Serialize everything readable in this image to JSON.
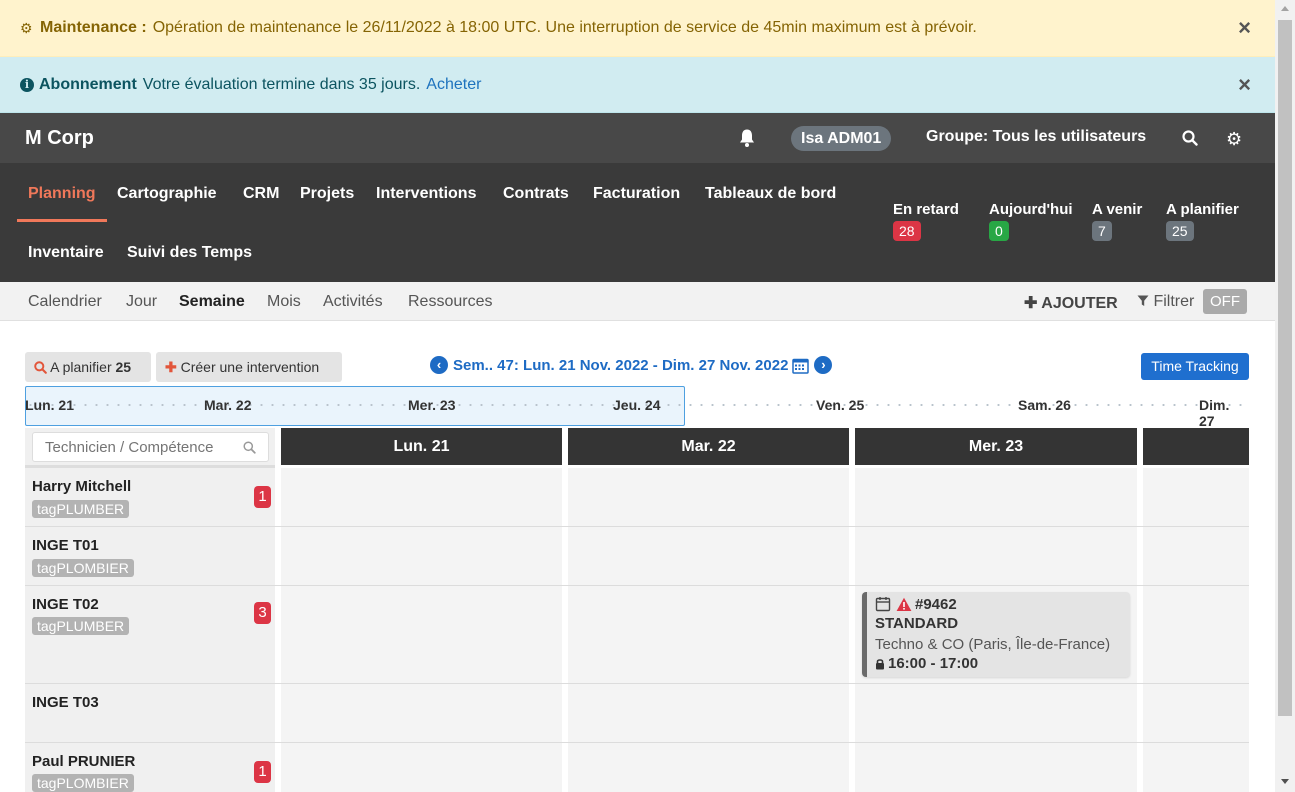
{
  "alerts": {
    "maintenance": {
      "title": "Maintenance :",
      "message": "Opération de maintenance le 26/11/2022 à 18:00 UTC. Une interruption de service de 45min maximum est à prévoir."
    },
    "subscription": {
      "title": "Abonnement",
      "message": "Votre évaluation termine dans 35 jours.",
      "link": "Acheter"
    },
    "close_glyph": "×"
  },
  "topbar": {
    "brand": "M Corp",
    "user": "Isa ADM01",
    "group": "Groupe: Tous les utilisateurs"
  },
  "mainnav": {
    "items": [
      "Planning",
      "Cartographie",
      "CRM",
      "Projets",
      "Interventions",
      "Contrats",
      "Facturation",
      "Tableaux de bord",
      "Inventaire",
      "Suivi des Temps"
    ],
    "stats": [
      {
        "label": "En retard",
        "value": "28",
        "color": "#dc3545"
      },
      {
        "label": "Aujourd'hui",
        "value": "0",
        "color": "#28a745"
      },
      {
        "label": "A venir",
        "value": "7",
        "color": "#6c757d"
      },
      {
        "label": "A planifier",
        "value": "25",
        "color": "#6c757d"
      }
    ]
  },
  "subnav": {
    "items": [
      "Calendrier",
      "Jour",
      "Semaine",
      "Mois",
      "Activités",
      "Ressources"
    ],
    "active": "Semaine",
    "add_label": "AJOUTER",
    "filter_label": "Filtrer",
    "filter_state": "OFF"
  },
  "toolbar": {
    "to_plan_label": "A planifier",
    "to_plan_count": "25",
    "create_label": "Créer une intervention",
    "week_label": "Sem.. 47: Lun. 21 Nov. 2022 - Dim. 27 Nov. 2022",
    "time_tracking": "Time Tracking"
  },
  "daystrip": [
    "Lun. 21",
    "Mar. 22",
    "Mer. 23",
    "Jeu. 24",
    "Ven. 25",
    "Sam. 26",
    "Dim. 27"
  ],
  "grid": {
    "search_placeholder": "Technicien / Compétence",
    "days": [
      "Lun. 21",
      "Mar. 22",
      "Mer. 23"
    ],
    "technicians": [
      {
        "name": "Harry Mitchell",
        "tag": "tagPLUMBER",
        "count": "1"
      },
      {
        "name": "INGE T01",
        "tag": "tagPLOMBIER",
        "count": ""
      },
      {
        "name": "INGE T02",
        "tag": "tagPLUMBER",
        "count": "3"
      },
      {
        "name": "INGE T03",
        "tag": "",
        "count": ""
      },
      {
        "name": "Paul PRUNIER",
        "tag": "tagPLOMBIER",
        "count": "1"
      }
    ]
  },
  "event": {
    "number": "#9462",
    "type": "STANDARD",
    "client": "Techno & CO (Paris, Île-de-France)",
    "time": "16:00 - 17:00"
  }
}
